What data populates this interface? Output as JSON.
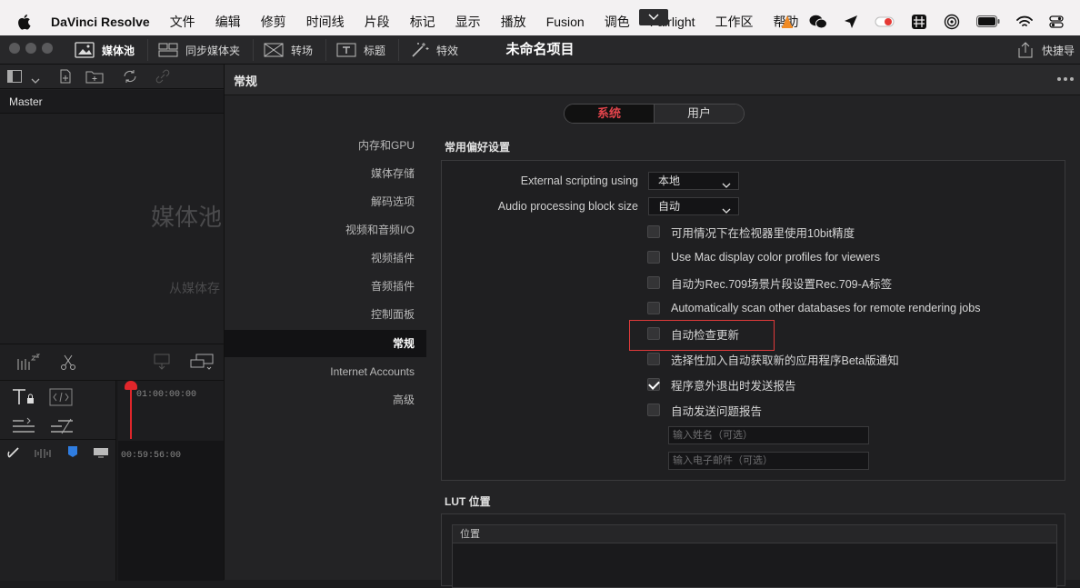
{
  "menubar": {
    "app_name": "DaVinci Resolve",
    "items": [
      "文件",
      "编辑",
      "修剪",
      "时间线",
      "片段",
      "标记",
      "显示",
      "播放",
      "Fusion",
      "调色",
      "Fairlight",
      "工作区",
      "帮助"
    ]
  },
  "toolbar": {
    "media_pool": "媒体池",
    "sync_bin": "同步媒体夹",
    "transitions": "转场",
    "titles": "标题",
    "effects": "特效",
    "project_title": "未命名项目",
    "shortcut": "快捷导"
  },
  "left_panel": {
    "master": "Master",
    "empty_title": "媒体池",
    "empty_hint": "从媒体存",
    "timecode_top": "01:00:00:00",
    "timecode_bottom": "00:59:56:00"
  },
  "preferences": {
    "title": "常规",
    "tabs": {
      "system": "系统",
      "user": "用户",
      "active": "系统"
    },
    "nav": [
      "内存和GPU",
      "媒体存储",
      "解码选项",
      "视频和音频I/O",
      "视频插件",
      "音频插件",
      "控制面板",
      "常规",
      "Internet Accounts",
      "高级"
    ],
    "nav_active": "常规",
    "general_section": "常用偏好设置",
    "external_scripting_label": "External scripting using",
    "external_scripting_value": "本地",
    "audio_block_label": "Audio processing block size",
    "audio_block_value": "自动",
    "checkboxes": [
      {
        "label": "可用情况下在检视器里使用10bit精度",
        "checked": false
      },
      {
        "label": "Use Mac display color profiles for viewers",
        "checked": false
      },
      {
        "label": "自动为Rec.709场景片段设置Rec.709-A标签",
        "checked": false
      },
      {
        "label": "Automatically scan other databases for remote rendering jobs",
        "checked": false
      },
      {
        "label": "自动检查更新",
        "checked": false
      },
      {
        "label": "选择性加入自动获取新的应用程序Beta版通知",
        "checked": false
      },
      {
        "label": "程序意外退出时发送报告",
        "checked": true
      },
      {
        "label": "自动发送问题报告",
        "checked": false
      }
    ],
    "name_placeholder": "输入姓名（可选）",
    "email_placeholder": "输入电子邮件（可选）",
    "lut_section": "LUT 位置",
    "lut_column": "位置"
  },
  "colors": {
    "accent_red": "#e2444b",
    "highlight": "#e03a3a"
  }
}
